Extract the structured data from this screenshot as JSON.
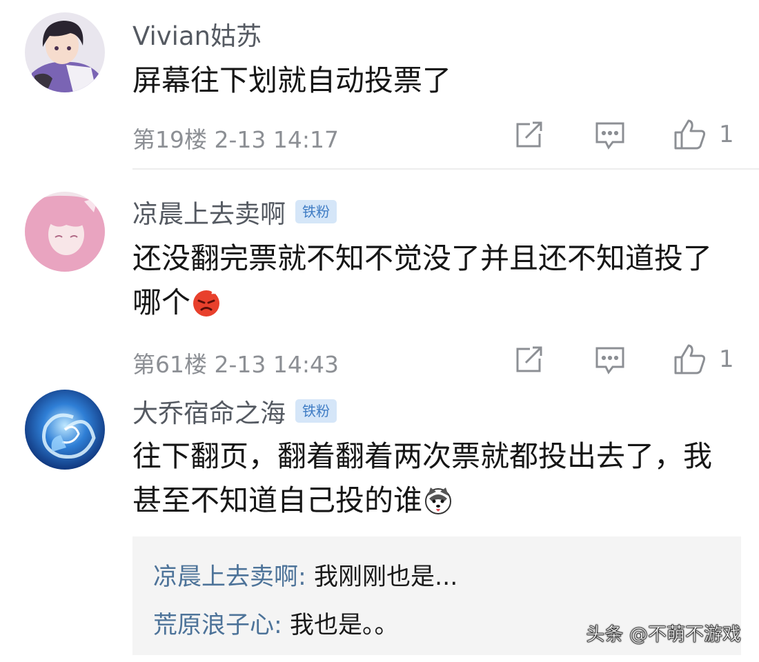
{
  "comments": [
    {
      "username": "Vivian姑苏",
      "badge": "",
      "content": "屏幕往下划就自动投票了",
      "floor": "第19楼",
      "datetime": "2-13 14:17",
      "likes": "1",
      "avatar_icon": "anime-boy-avatar"
    },
    {
      "username": "凉晨上去卖啊",
      "badge": "铁粉",
      "content": "还没翻完票就不知不觉没了并且还不知道投了哪个",
      "emoji": "angry-face-emoji",
      "floor": "第61楼",
      "datetime": "2-13 14:43",
      "likes": "1",
      "avatar_icon": "anime-girl-pink-avatar"
    },
    {
      "username": "大乔宿命之海",
      "badge": "铁粉",
      "content": "往下翻页，翻着翻着两次票就都投出去了，我甚至不知道自己投的谁",
      "emoji": "husky-dog-emoji",
      "avatar_icon": "blue-swirl-avatar",
      "replies": [
        {
          "user": "凉晨上去卖啊",
          "separator": ": ",
          "text": "我刚刚也是..."
        },
        {
          "user": "荒原浪子心",
          "separator": ": ",
          "text": "我也是。。"
        }
      ]
    }
  ],
  "watermark": "头条 @不萌不游戏",
  "colors": {
    "username": "#555a62",
    "badge_bg": "#d5e6f8",
    "badge_text": "#3f7cc4",
    "meta": "#8c8f94",
    "reply_user": "#4d7399",
    "reply_bg": "#f4f4f4"
  },
  "icons": {
    "share": "share-arrow-icon",
    "reply": "comment-bubble-icon",
    "like": "thumbs-up-icon"
  }
}
